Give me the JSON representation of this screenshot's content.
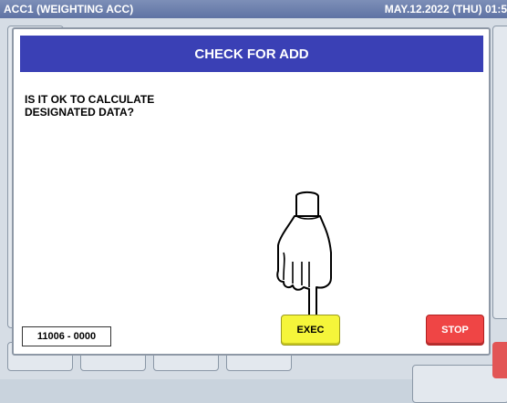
{
  "status_bar": {
    "title": "ACC1 (WEIGHTING ACC)",
    "datetime": "MAY.12.2022 (THU)  01:5"
  },
  "dialog": {
    "title": "CHECK FOR ADD",
    "message": "IS IT OK TO CALCULATE\nDESIGNATED DATA?",
    "code": "11006 - 0000",
    "exec_label": "EXEC",
    "stop_label": "STOP"
  },
  "icons": {
    "pointer": "pointing-hand-icon"
  },
  "colors": {
    "header": "#3a40b5",
    "exec": "#f5f53a",
    "stop": "#ef4545"
  }
}
